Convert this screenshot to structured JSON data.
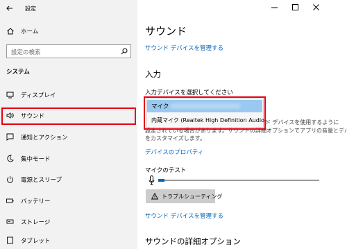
{
  "window": {
    "title": "設定"
  },
  "sidebar": {
    "home_label": "ホーム",
    "search_placeholder": "設定の検索",
    "section_title": "システム",
    "items": [
      {
        "label": "ディスプレイ",
        "icon": "display-icon"
      },
      {
        "label": "サウンド",
        "icon": "speaker-icon"
      },
      {
        "label": "通知とアクション",
        "icon": "notification-icon"
      },
      {
        "label": "集中モード",
        "icon": "moon-icon"
      },
      {
        "label": "電源とスリープ",
        "icon": "power-icon"
      },
      {
        "label": "バッテリー",
        "icon": "battery-icon"
      },
      {
        "label": "ストレージ",
        "icon": "storage-icon"
      },
      {
        "label": "タブレット",
        "icon": "tablet-icon"
      }
    ]
  },
  "main": {
    "title": "サウンド",
    "manage_link": "サウンド デバイスを管理する",
    "input_heading": "入力",
    "choose_label": "入力デバイスを選択してください",
    "dropdown_options": [
      {
        "label": "マイク"
      },
      {
        "label": "内蔵マイク (Realtek High Definition Audio)"
      }
    ],
    "behind_text_line1": "ド デバイスを使用するように",
    "behind_text_line2": "設定されている場合があります。サウンドの詳細オプションでアプリの音量とデバイス",
    "behind_text_line3": "をカスタマイズします。",
    "device_properties_link": "デバイスのプロパティ",
    "mic_test_label": "マイクのテスト",
    "mic_level": 0.04,
    "troubleshoot_label": "トラブルシューティング",
    "manage_link2": "サウンド デバイスを管理する",
    "advanced_heading": "サウンドの詳細オプション"
  },
  "colors": {
    "accent": "#0067c0",
    "highlight": "#99c9f0",
    "annotation": "#e60012"
  }
}
